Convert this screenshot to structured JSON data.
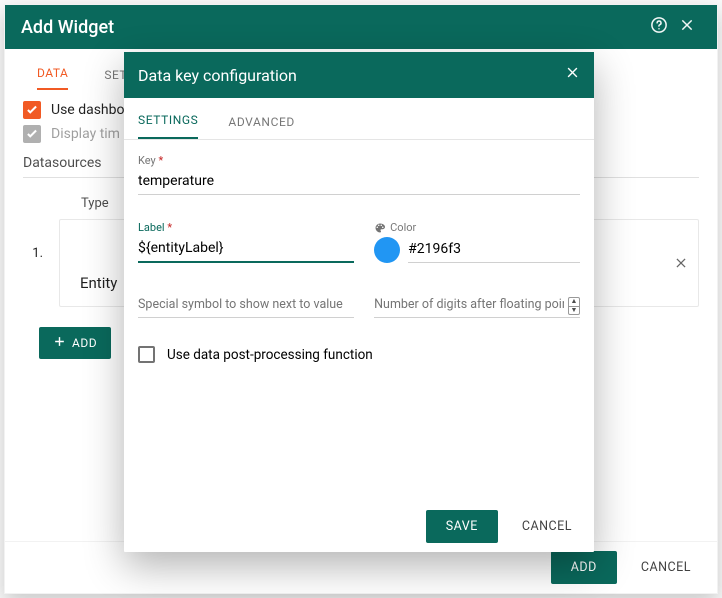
{
  "outer": {
    "title": "Add Widget",
    "tabs": {
      "data": "DATA",
      "settings": "SET"
    },
    "useDashboard": "Use dashbo",
    "displayTime": "Display tim",
    "datasources": "Datasources",
    "typeHeader": "Type",
    "row1": {
      "num": "1.",
      "entity": "Entity"
    },
    "addBtn": "ADD",
    "footer": {
      "add": "ADD",
      "cancel": "CANCEL"
    }
  },
  "inner": {
    "title": "Data key configuration",
    "tabs": {
      "settings": "SETTINGS",
      "advanced": "ADVANCED"
    },
    "keyLabel": "Key",
    "keyValue": "temperature",
    "labelLabel": "Label",
    "labelValue": "${entityLabel}",
    "colorLabel": "Color",
    "colorValue": "#2196f3",
    "symbolPlaceholder": "Special symbol to show next to value",
    "digitsPlaceholder": "Number of digits after floating point",
    "postProcess": "Use data post-processing function",
    "footer": {
      "save": "SAVE",
      "cancel": "CANCEL"
    }
  }
}
